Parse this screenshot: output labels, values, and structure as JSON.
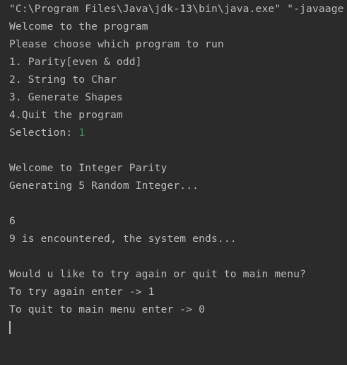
{
  "console": {
    "command_line": "\"C:\\Program Files\\Java\\jdk-13\\bin\\java.exe\" \"-javaage",
    "welcome": "Welcome to the program",
    "choose_prompt": "Please choose which program to run",
    "menu_items": [
      "1. Parity[even & odd]",
      "2. String to Char",
      "3. Generate Shapes",
      "4.Quit the program"
    ],
    "selection_label": "Selection: ",
    "selection_value": "1",
    "parity_welcome": "Welcome to Integer Parity",
    "generating": "Generating 5 Random Integer...",
    "numbers": [
      "6"
    ],
    "end_message": "9 is encountered, the system ends...",
    "retry_prompt": "Would u like to try again or quit to main menu?",
    "retry_option": "To try again enter -> 1",
    "quit_option": "To quit to main menu enter -> 0"
  },
  "colors": {
    "background": "#2b2b2b",
    "text": "#bbbbbb",
    "user_input": "#1f9f3c"
  }
}
